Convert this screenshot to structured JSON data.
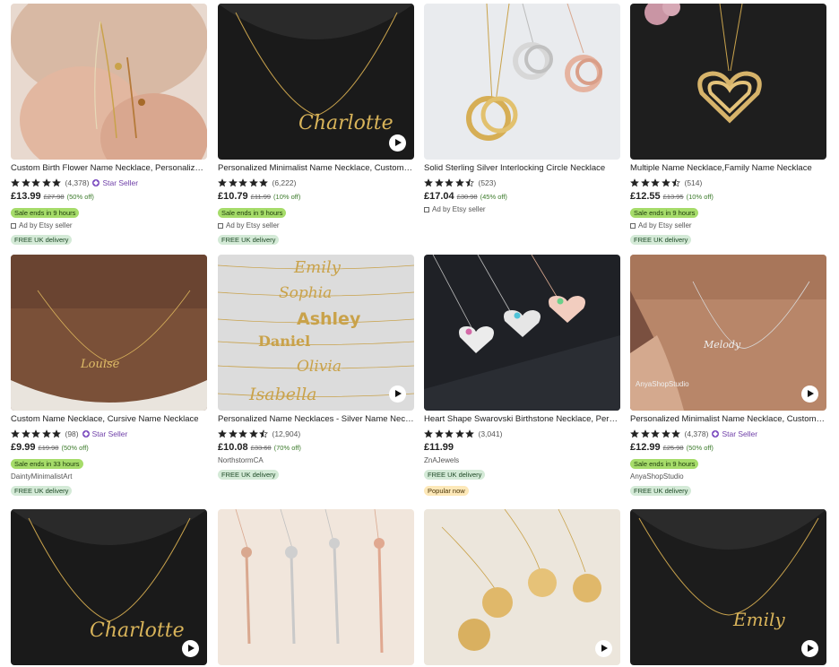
{
  "colors": {
    "star": "#222222",
    "sale_badge": "#a6dc6a",
    "free_badge": "#d4ead7",
    "star_seller": "#6f3fa8",
    "discount": "#3b7a2a"
  },
  "listings": [
    {
      "title": "Custom Birth Flower Name Necklace, Personalized Flower Necklace",
      "rating": 5,
      "reviews": "(4,378)",
      "star_seller": "Star Seller",
      "price": "£13.99",
      "was": "£27.98",
      "off": "(50% off)",
      "sale": "Sale ends in 9 hours",
      "ad": "Ad by Etsy seller",
      "shop": "",
      "free": "FREE UK delivery",
      "popular": "",
      "video": false,
      "icon": "flower-name-necklace-photo"
    },
    {
      "title": "Personalized Minimalist Name Necklace, Custom Name Necklace",
      "rating": 5,
      "reviews": "(6,222)",
      "star_seller": "",
      "price": "£10.79",
      "was": "£11.99",
      "off": "(10% off)",
      "sale": "Sale ends in 9 hours",
      "ad": "Ad by Etsy seller",
      "shop": "",
      "free": "FREE UK delivery",
      "popular": "",
      "video": true,
      "icon": "charlotte-necklace-photo"
    },
    {
      "title": "Solid Sterling Silver Interlocking Circle Necklace",
      "rating": 4.5,
      "reviews": "(523)",
      "star_seller": "",
      "price": "£17.04",
      "was": "£30.98",
      "off": "(45% off)",
      "sale": "",
      "ad": "Ad by Etsy seller",
      "shop": "",
      "free": "",
      "popular": "",
      "video": false,
      "icon": "interlocking-circles-photo"
    },
    {
      "title": "Multiple Name Necklace,Family Name Necklace",
      "rating": 4.5,
      "reviews": "(514)",
      "star_seller": "",
      "price": "£12.55",
      "was": "£13.95",
      "off": "(10% off)",
      "sale": "Sale ends in 9 hours",
      "ad": "Ad by Etsy seller",
      "shop": "",
      "free": "FREE UK delivery",
      "popular": "",
      "video": false,
      "icon": "heart-name-necklace-photo"
    },
    {
      "title": "Custom Name Necklace, Cursive Name Necklace",
      "rating": 5,
      "reviews": "(98)",
      "star_seller": "Star Seller",
      "price": "£9.99",
      "was": "£19.98",
      "off": "(50% off)",
      "sale": "Sale ends in 33 hours",
      "ad": "",
      "shop": "DaintyMinimalistArt",
      "free": "FREE UK delivery",
      "popular": "",
      "video": false,
      "icon": "louise-necklace-photo"
    },
    {
      "title": "Personalized Name Necklaces - Silver Name Necklace",
      "rating": 4.5,
      "reviews": "(12,904)",
      "star_seller": "",
      "price": "£10.08",
      "was": "£33.60",
      "off": "(70% off)",
      "sale": "",
      "ad": "",
      "shop": "NorthstormCA",
      "free": "FREE UK delivery",
      "popular": "",
      "video": true,
      "icon": "name-styles-photo"
    },
    {
      "title": "Heart Shape Swarovski Birthstone Necklace, Personalized",
      "rating": 5,
      "reviews": "(3,041)",
      "star_seller": "",
      "price": "£11.99",
      "was": "",
      "off": "",
      "sale": "",
      "ad": "",
      "shop": "ZnAJewels",
      "free": "FREE UK delivery",
      "popular": "Popular now",
      "video": false,
      "icon": "heart-birthstone-photo"
    },
    {
      "title": "Personalized Minimalist Name Necklace, Custom Name",
      "rating": 5,
      "reviews": "(4,378)",
      "star_seller": "Star Seller",
      "price": "£12.99",
      "was": "£25.98",
      "off": "(50% off)",
      "sale": "Sale ends in 9 hours",
      "ad": "",
      "shop": "AnyaShopStudio",
      "free": "FREE UK delivery",
      "popular": "",
      "video": true,
      "icon": "melody-necklace-photo",
      "watermark": "AnyaShopStudio"
    },
    {
      "title": "",
      "video": true,
      "icon": "charlotte-necklace-photo"
    },
    {
      "title": "",
      "video": false,
      "icon": "flower-bar-necklaces-photo"
    },
    {
      "title": "",
      "video": true,
      "icon": "disc-flower-necklaces-photo"
    },
    {
      "title": "",
      "video": true,
      "icon": "emily-necklace-photo"
    }
  ]
}
